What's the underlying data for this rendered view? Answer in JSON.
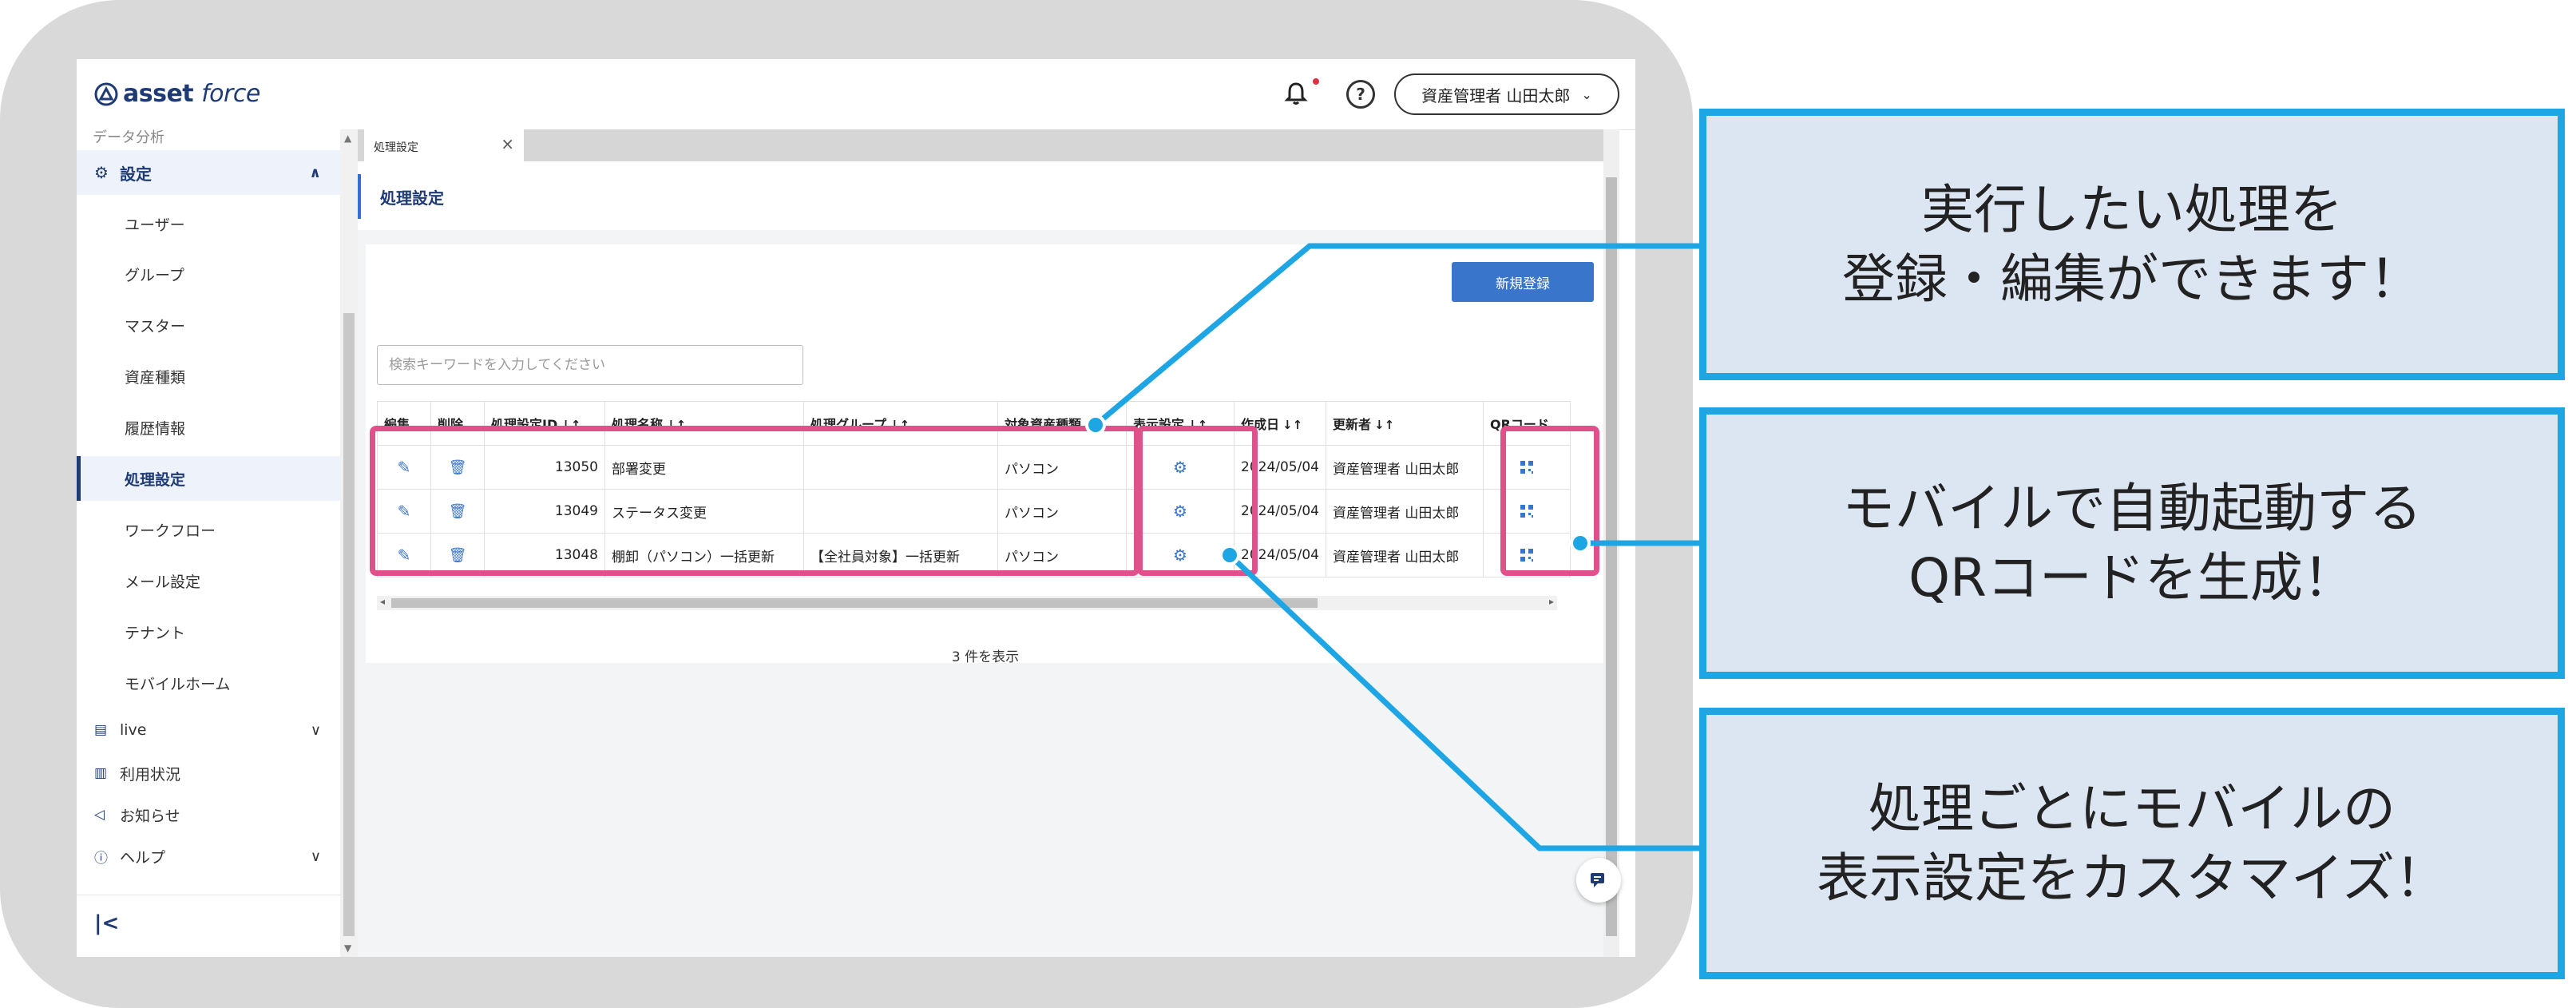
{
  "app": {
    "logo_primary": "asset",
    "logo_secondary": "force",
    "user_label": "資産管理者 山田太郎"
  },
  "sidebar": {
    "cut_item": "データ分析",
    "section": {
      "label": "設定",
      "icon": "gear-icon"
    },
    "items": [
      {
        "label": "ユーザー"
      },
      {
        "label": "グループ"
      },
      {
        "label": "マスター"
      },
      {
        "label": "資産種類"
      },
      {
        "label": "履歴情報"
      },
      {
        "label": "処理設定",
        "active": true
      },
      {
        "label": "ワークフロー"
      },
      {
        "label": "メール設定"
      },
      {
        "label": "テナント"
      },
      {
        "label": "モバイルホーム"
      }
    ],
    "top_items": [
      {
        "label": "live",
        "icon": "chat-icon"
      },
      {
        "label": "利用状況",
        "icon": "bar-chart-icon"
      },
      {
        "label": "お知らせ",
        "icon": "megaphone-icon"
      },
      {
        "label": "ヘルプ",
        "icon": "help-icon"
      }
    ],
    "collapse_label": "|<"
  },
  "tab": {
    "label": "処理設定"
  },
  "page": {
    "title": "処理設定",
    "new_button": "新規登録",
    "search_placeholder": "検索キーワードを入力してください",
    "count_text": "3 件を表示"
  },
  "table": {
    "headers": [
      "編集",
      "削除",
      "処理設定ID",
      "処理名称",
      "処理グループ",
      "対象資産種類",
      "表示設定",
      "作成日",
      "更新者",
      "QRコード"
    ],
    "rows": [
      {
        "id": "13050",
        "name": "部署変更",
        "group": "",
        "asset_type": "パソコン",
        "created": "2024/05/04",
        "updater": "資産管理者 山田太郎"
      },
      {
        "id": "13049",
        "name": "ステータス変更",
        "group": "",
        "asset_type": "パソコン",
        "created": "2024/05/04",
        "updater": "資産管理者 山田太郎"
      },
      {
        "id": "13048",
        "name": "棚卸（パソコン）一括更新",
        "group": "【全社員対象】一括更新",
        "asset_type": "パソコン",
        "created": "2024/05/04",
        "updater": "資産管理者 山田太郎"
      }
    ]
  },
  "callouts": [
    {
      "text": "実行したい処理を\n登録・編集ができます！"
    },
    {
      "text": "モバイルで自動起動する\nQRコードを生成！"
    },
    {
      "text": "処理ごとにモバイルの\n表示設定をカスタマイズ！"
    }
  ],
  "colors": {
    "accent": "#3a75cc",
    "highlight": "#e0508a",
    "callout_border": "#1ea6e4",
    "callout_fill": "#dce6f2"
  }
}
